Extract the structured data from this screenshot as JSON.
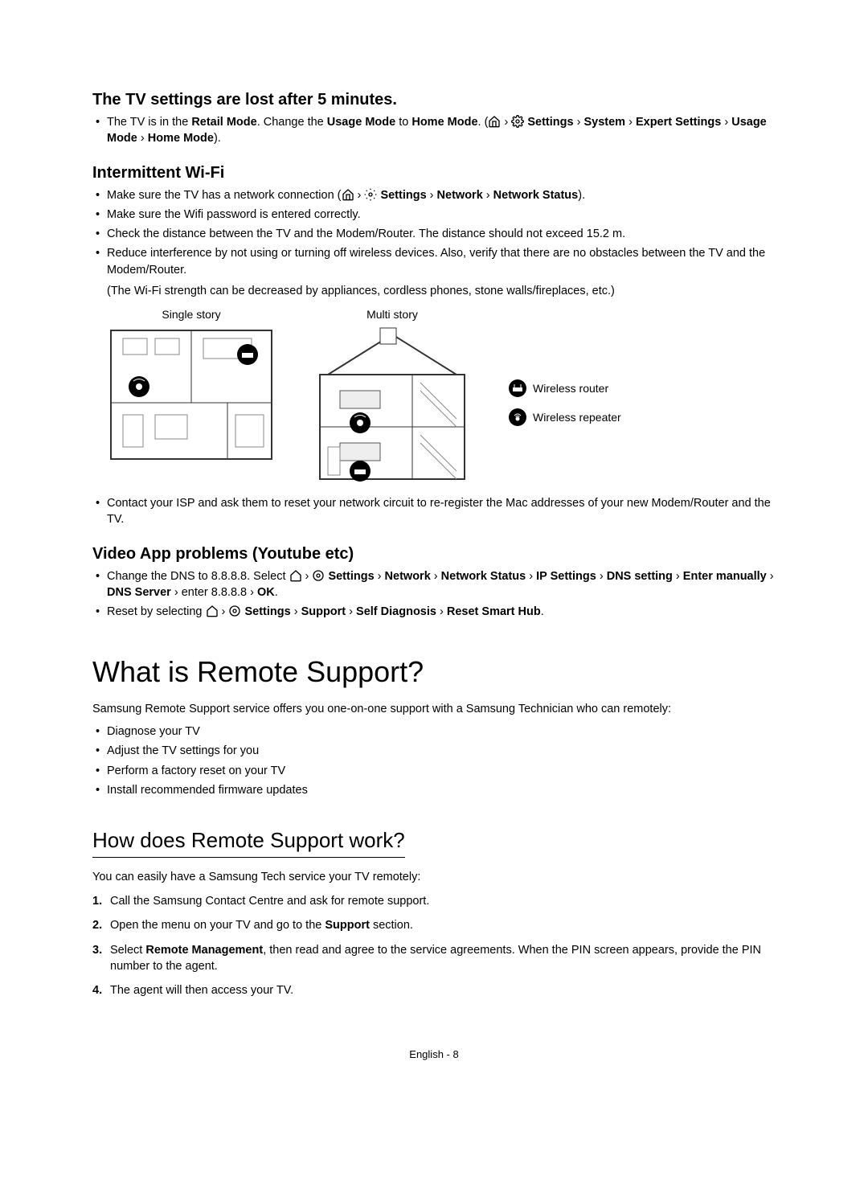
{
  "section_settings_lost": {
    "heading": "The TV settings are lost after 5 minutes.",
    "bullet1_a": "The TV is in the ",
    "bullet1_retail": "Retail Mode",
    "bullet1_b": ". Change the ",
    "bullet1_usage": "Usage Mode",
    "bullet1_c": " to ",
    "bullet1_home": "Home Mode",
    "bullet1_d": ". (",
    "nav1_settings": "Settings",
    "nav1_system": "System",
    "nav1_expert": "Expert Settings",
    "nav1_usage": "Usage Mode",
    "nav1_home": "Home Mode",
    "bullet1_close": ")."
  },
  "section_wifi": {
    "heading": "Intermittent Wi-Fi",
    "b1_a": "Make sure the TV has a network connection (",
    "b1_settings": "Settings",
    "b1_network": "Network",
    "b1_status": "Network Status",
    "b1_b": ").",
    "b2": "Make sure the Wifi password is entered correctly.",
    "b3": "Check the distance between the TV and the Modem/Router. The distance should not exceed 15.2 m.",
    "b4": "Reduce interference by not using or turning off wireless devices. Also, verify that there are no obstacles between the TV and the Modem/Router.",
    "b4_note": "(The Wi-Fi strength can be decreased by appliances, cordless phones, stone walls/fireplaces, etc.)",
    "diagram_single": "Single story",
    "diagram_multi": "Multi story",
    "legend_router": "Wireless router",
    "legend_repeater": "Wireless repeater",
    "b5": "Contact your ISP and ask them to reset your network circuit to re-register the Mac addresses of your new Modem/Router and the TV."
  },
  "section_video": {
    "heading": "Video App problems (Youtube etc)",
    "b1_a": "Change the DNS to 8.8.8.8. Select ",
    "b1_settings": "Settings",
    "b1_network": "Network",
    "b1_status": "Network Status",
    "b1_ip": "IP Settings",
    "b1_dns": "DNS setting",
    "b1_enter": "Enter manually",
    "b1_server": "DNS Server",
    "b1_val": " enter 8.8.8.8 ",
    "b1_ok": "OK",
    "b2_a": "Reset by selecting ",
    "b2_settings": "Settings",
    "b2_support": "Support",
    "b2_self": "Self Diagnosis",
    "b2_reset": "Reset Smart Hub"
  },
  "remote_support": {
    "heading": "What is Remote Support?",
    "intro": "Samsung Remote Support service offers you one-on-one support with a Samsung Technician who can remotely:",
    "b1": "Diagnose your TV",
    "b2": "Adjust the TV settings for you",
    "b3": "Perform a factory reset on your TV",
    "b4": "Install recommended firmware updates"
  },
  "how_works": {
    "heading": "How does Remote Support work?",
    "intro": "You can easily have a Samsung Tech service your TV remotely:",
    "s1": "Call the Samsung Contact Centre and ask for remote support.",
    "s2_a": "Open the menu on your TV and go to the ",
    "s2_support": "Support",
    "s2_b": " section.",
    "s3_a": "Select ",
    "s3_rm": "Remote Management",
    "s3_b": ", then read and agree to the service agreements. When the PIN screen appears, provide the PIN number to the agent.",
    "s4": "The agent will then access your TV."
  },
  "footer": "English - 8",
  "gt": "›"
}
